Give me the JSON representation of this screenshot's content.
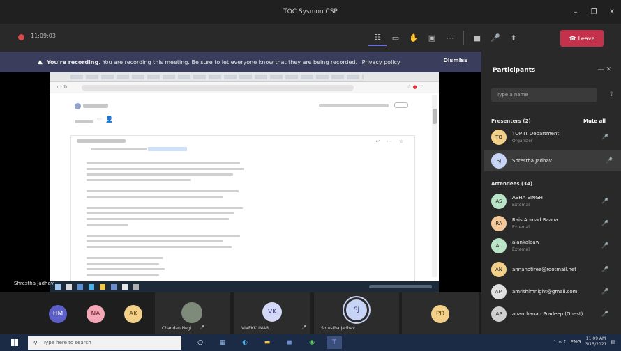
{
  "window": {
    "title": "TOC Sysmon CSP",
    "controls": [
      "–",
      "❐",
      "✕"
    ]
  },
  "toolbar": {
    "timer": "11:09:03",
    "icons": [
      "participants-icon",
      "chat-icon",
      "raise-hand-icon",
      "more-icon",
      "camera-icon",
      "mic-icon",
      "share-icon"
    ],
    "leave_label": "Leave"
  },
  "banner": {
    "bold": "You're recording.",
    "message": "You are recording this meeting. Be sure to let everyone know that they are being recorded.",
    "link": "Privacy policy",
    "dismiss": "Dismiss"
  },
  "stage": {
    "presenter_name": "Shrestha Jadhav"
  },
  "strip": {
    "tiles": [
      {
        "initials": "HM",
        "color": "#5b5fc7",
        "text": "#ffffff"
      },
      {
        "initials": "NA",
        "color": "#f4a7b6",
        "text": "#6b1f2e"
      },
      {
        "initials": "AK",
        "color": "#f3d08a",
        "text": "#6b4a10"
      },
      {
        "initials": "",
        "name": "Chandan Negi"
      },
      {
        "initials": "VK",
        "color": "#d4d8f7",
        "text": "#3b3f8c",
        "name": "VIVEKKUMAR"
      },
      {
        "initials": "SJ",
        "color": "#c7d4f6",
        "text": "#2f3a6e",
        "name": "Shrestha Jadhav"
      },
      {
        "initials": "PD",
        "color": "#f3d08a",
        "text": "#6b4a10"
      }
    ]
  },
  "panel": {
    "title": "Participants",
    "invite_placeholder": "Type a name",
    "presenters_label": "Presenters (2)",
    "mute_all": "Mute all",
    "attendees_label": "Attendees (34)",
    "presenters": [
      {
        "initials": "TO",
        "name": "TOP IT Department",
        "role": "Organizer",
        "color": "#f3d08a"
      },
      {
        "initials": "SJ",
        "name": "Shrestha Jadhav",
        "role": "",
        "color": "#c7d4f6"
      }
    ],
    "attendees": [
      {
        "initials": "AS",
        "name": "ASHA SINGH",
        "role": "External",
        "color": "#b9e3c6"
      },
      {
        "initials": "RA",
        "name": "Rais Ahmad Raana",
        "role": "External",
        "color": "#f3c89a"
      },
      {
        "initials": "AL",
        "name": "alankalaaw",
        "role": "External",
        "color": "#b9e3c6"
      },
      {
        "initials": "AN",
        "name": "annanotiree@rootmail.net",
        "role": "",
        "color": "#f3d08a"
      },
      {
        "initials": "AM",
        "name": "amrithimnight@gmail.com",
        "role": "",
        "color": "#e0e0e0"
      },
      {
        "initials": "AP",
        "name": "ananthanan Pradeep (Guest)",
        "role": "",
        "color": "#d0d0d0"
      }
    ]
  },
  "taskbar": {
    "search_placeholder": "Type here to search",
    "time": "11:09 AM",
    "date": "3/15/2021",
    "lang": "ENG"
  }
}
